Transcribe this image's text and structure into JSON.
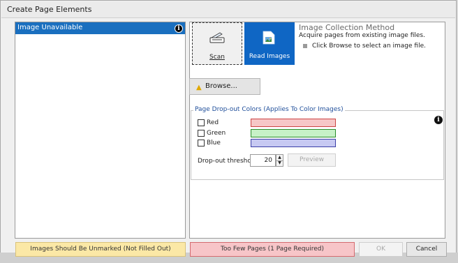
{
  "window": {
    "title": "Create Page Elements"
  },
  "colors": {
    "selection": "#1a6fbf",
    "read_images_active": "#0f66c4",
    "warning_yellow": "#fbe8a6",
    "error_red": "#f7c5c8",
    "group_title": "#1f4e9a"
  },
  "left_list": {
    "items": [
      {
        "label": "Image Unavailable",
        "selected": true,
        "icon": "info-icon"
      }
    ]
  },
  "collection": {
    "scan": {
      "label": "Scan",
      "icon": "scanner-icon"
    },
    "read_images": {
      "label": "Read Images",
      "icon": "image-file-icon",
      "active": true
    },
    "method_title": "Image Collection Method",
    "method_description": "Acquire pages from existing image files.",
    "hint": "Click Browse to select an image file."
  },
  "browse": {
    "label": "Browse...",
    "icon": "folder-icon"
  },
  "dropout": {
    "group_title": "Page Drop-out Colors (Applies To Color Images)",
    "colors": [
      {
        "label": "Red",
        "checked": false,
        "swatch": "#f6c7c7"
      },
      {
        "label": "Green",
        "checked": false,
        "swatch": "#c7f1c7"
      },
      {
        "label": "Blue",
        "checked": false,
        "swatch": "#c7c9f2"
      }
    ],
    "threshold_label": "Drop-out threshold:",
    "threshold_value": "20",
    "preview_label": "Preview"
  },
  "status": {
    "left_message": "Images Should Be Unmarked (Not Filled Out)",
    "right_message": "Too Few Pages (1 Page Required)"
  },
  "buttons": {
    "ok": "OK",
    "cancel": "Cancel"
  }
}
